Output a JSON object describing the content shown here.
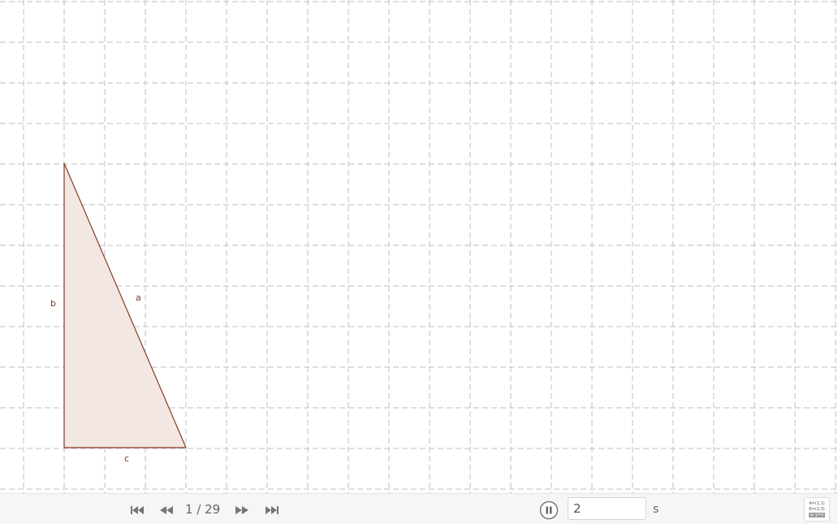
{
  "graphics": {
    "grid": "dashed",
    "triangle": {
      "fill_color": "#f2e7e2",
      "stroke_color": "#8b3a22",
      "labels": {
        "a": "a",
        "b": "b",
        "c": "c"
      }
    }
  },
  "toolbar": {
    "step_counter": "1 / 29",
    "speed_value": "2",
    "speed_unit": "s",
    "icons": {
      "first": "skip-to-start-icon",
      "previous": "rewind-icon",
      "next": "fast-forward-icon",
      "last": "skip-to-end-icon",
      "play_pause": "pause-icon"
    },
    "algebra_preview": {
      "line1": "A=(1,1)",
      "line2": "B=(2,3)",
      "line3": "a: y=x"
    }
  }
}
